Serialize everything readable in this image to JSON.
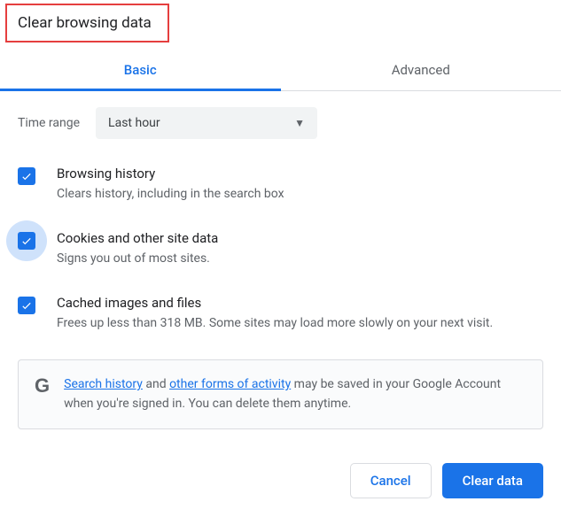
{
  "title": "Clear browsing data",
  "tabs": {
    "basic": "Basic",
    "advanced": "Advanced"
  },
  "timerange": {
    "label": "Time range",
    "selected": "Last hour"
  },
  "options": {
    "browsing_history": {
      "heading": "Browsing history",
      "desc": "Clears history, including in the search box"
    },
    "cookies": {
      "heading": "Cookies and other site data",
      "desc": "Signs you out of most sites."
    },
    "cached": {
      "heading": "Cached images and files",
      "desc": "Frees up less than 318 MB. Some sites may load more slowly on your next visit."
    }
  },
  "notice": {
    "link1": "Search history",
    "mid1": " and ",
    "link2": "other forms of activity",
    "tail": " may be saved in your Google Account when you're signed in. You can delete them anytime."
  },
  "actions": {
    "cancel": "Cancel",
    "clear": "Clear data"
  }
}
